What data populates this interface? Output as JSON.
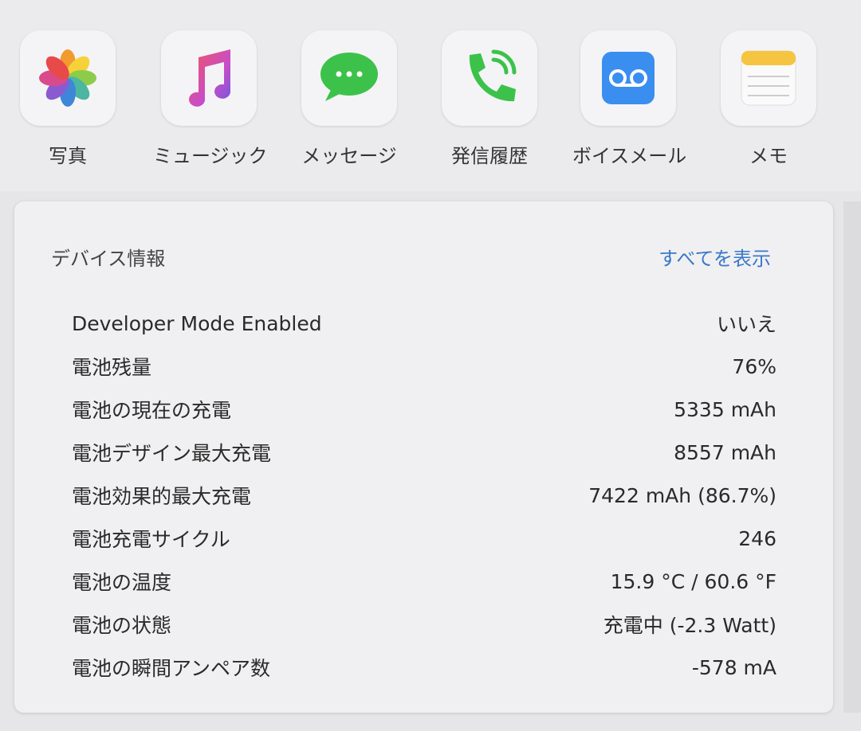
{
  "apps": [
    {
      "label": "写真",
      "icon": "photos-icon"
    },
    {
      "label": "ミュージック",
      "icon": "music-icon"
    },
    {
      "label": "メッセージ",
      "icon": "messages-icon"
    },
    {
      "label": "発信履歴",
      "icon": "call-history-icon"
    },
    {
      "label": "ボイスメール",
      "icon": "voicemail-icon"
    },
    {
      "label": "メモ",
      "icon": "notes-icon"
    }
  ],
  "device_info": {
    "title": "デバイス情報",
    "show_all": "すべてを表示",
    "rows": [
      {
        "key": "Developer Mode Enabled",
        "value": "いいえ"
      },
      {
        "key": "電池残量",
        "value": "76%"
      },
      {
        "key": "電池の現在の充電",
        "value": "5335 mAh"
      },
      {
        "key": "電池デザイン最大充電",
        "value": "8557 mAh"
      },
      {
        "key": "電池効果的最大充電",
        "value": "7422 mAh (86.7%)"
      },
      {
        "key": "電池充電サイクル",
        "value": "246"
      },
      {
        "key": "電池の温度",
        "value": "15.9 °C / 60.6 °F"
      },
      {
        "key": "電池の状態",
        "value": "充電中 (-2.3 Watt)"
      },
      {
        "key": "電池の瞬間アンペア数",
        "value": "-578 mA"
      }
    ]
  },
  "colors": {
    "accent": "#3a78c8",
    "music": "#e0435f",
    "messages": "#3cc24a",
    "phone": "#3cc24a",
    "voicemail": "#3a8ef0",
    "notes": "#f5c542"
  }
}
